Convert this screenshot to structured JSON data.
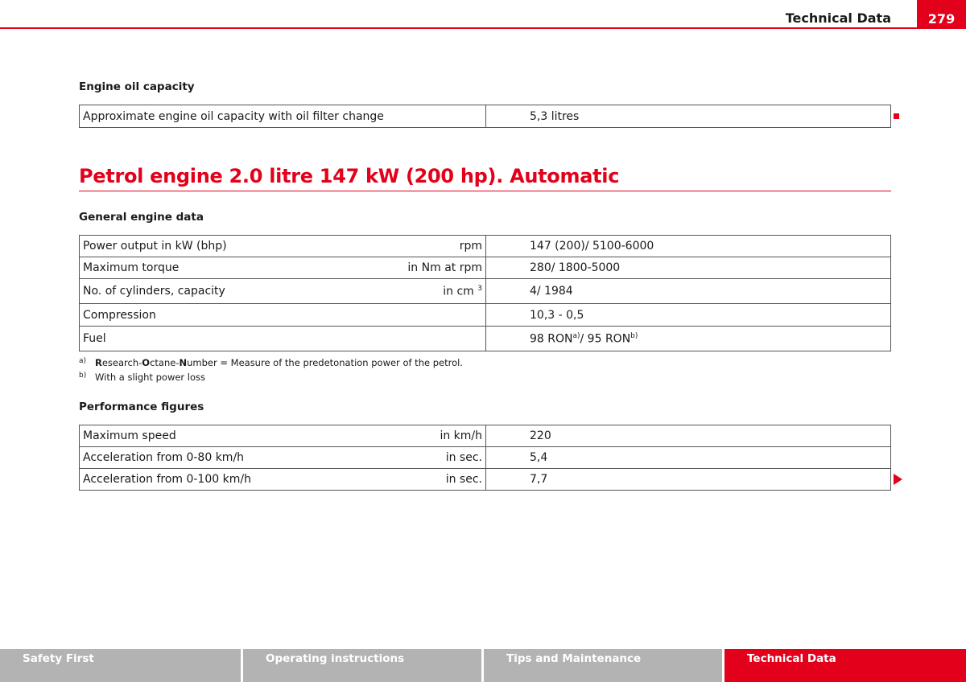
{
  "header": {
    "title": "Technical Data",
    "page_number": "279"
  },
  "oil": {
    "heading": "Engine oil capacity",
    "rows": [
      {
        "label": "Approximate engine oil capacity with oil filter change",
        "value": "5,3 litres"
      }
    ]
  },
  "section_title": "Petrol engine 2.0 litre 147 kW (200 hp). Automatic",
  "general": {
    "heading": "General engine data",
    "rows": [
      {
        "label": "Power output in kW (bhp)",
        "unit": "rpm",
        "value": "147 (200)/ 5100-6000"
      },
      {
        "label": "Maximum torque",
        "unit": "in Nm at rpm",
        "value": "280/ 1800-5000"
      },
      {
        "label": "No. of cylinders, capacity",
        "unit": "in cm",
        "unit_sup": "3",
        "value": "4/ 1984"
      },
      {
        "label": "Compression",
        "unit": "",
        "value": "10,3 - 0,5"
      },
      {
        "label": "Fuel",
        "unit": "",
        "value_a": "98 RON",
        "sup_a": "a)",
        "value_b": "/ 95 RON",
        "sup_b": "b)"
      }
    ]
  },
  "footnotes": [
    {
      "mark": "a)",
      "b1": "R",
      "t1": "esearch-",
      "b2": "O",
      "t2": "ctane-",
      "b3": "N",
      "t3": "umber = Measure of the predetonation power of the petrol."
    },
    {
      "mark": "b)",
      "text": "With a slight power loss"
    }
  ],
  "performance": {
    "heading": "Performance figures",
    "rows": [
      {
        "label": "Maximum speed",
        "unit": "in km/h",
        "value": "220"
      },
      {
        "label": "Acceleration from 0-80 km/h",
        "unit": "in sec.",
        "value": "5,4"
      },
      {
        "label": "Acceleration from 0-100 km/h",
        "unit": "in sec.",
        "value": "7,7"
      }
    ]
  },
  "footer_tabs": [
    {
      "label": "Safety First",
      "active": false
    },
    {
      "label": "Operating instructions",
      "active": false
    },
    {
      "label": "Tips and Maintenance",
      "active": false
    },
    {
      "label": "Technical Data",
      "active": true
    }
  ],
  "colors": {
    "accent": "#e2001a",
    "footer_gray": "#b3b3b3"
  },
  "icons": {
    "end_marker": "square-end-marker-icon",
    "continue_marker": "arrow-right-continue-icon"
  }
}
